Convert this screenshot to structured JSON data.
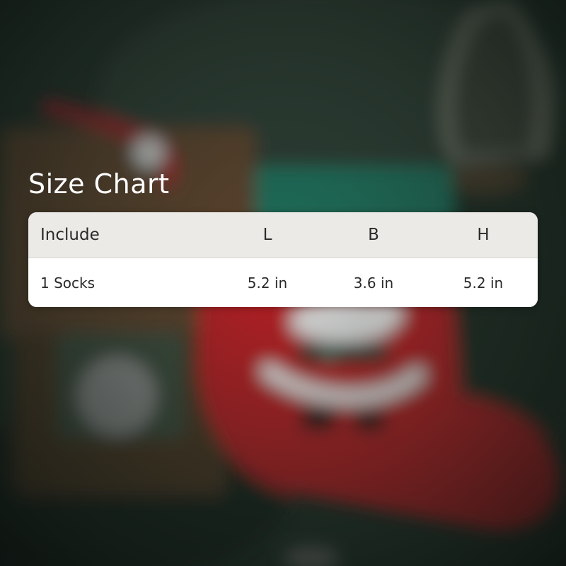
{
  "title": "Size Chart",
  "table": {
    "headers": [
      "Include",
      "L",
      "B",
      "H"
    ],
    "rows": [
      [
        "1 Socks",
        "5.2 in",
        "3.6 in",
        "5.2 in"
      ]
    ]
  },
  "colors": {
    "background": "#1c2620",
    "header_bg": "#eceae6",
    "body_bg": "#ffffff",
    "stocking_red": "#b81f24",
    "text": "#2a2a2a"
  }
}
